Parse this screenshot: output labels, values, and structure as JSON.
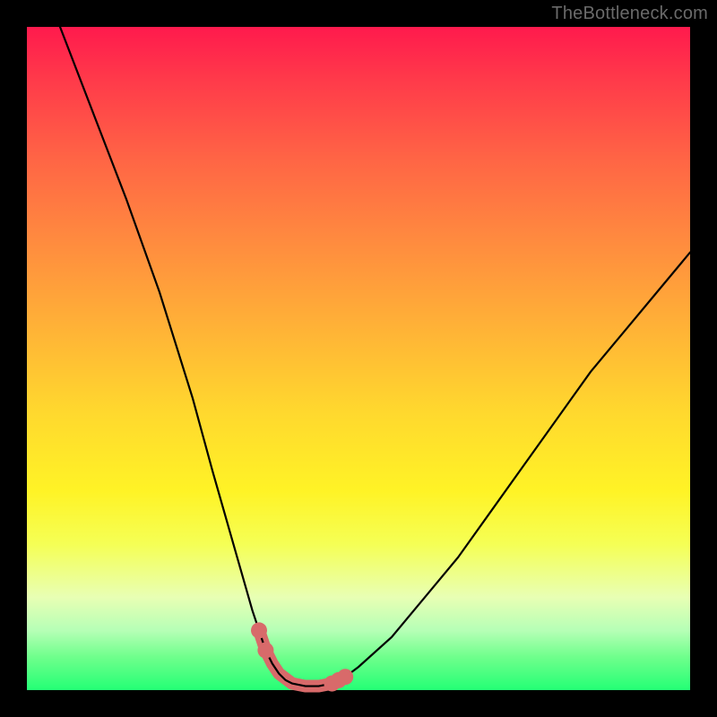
{
  "watermark": "TheBottleneck.com",
  "chart_data": {
    "type": "line",
    "title": "",
    "xlabel": "",
    "ylabel": "",
    "xlim": [
      0,
      100
    ],
    "ylim": [
      0,
      100
    ],
    "grid": false,
    "curve": {
      "x": [
        5,
        10,
        15,
        20,
        25,
        28,
        30,
        32,
        34,
        35,
        36,
        37,
        38,
        39,
        40,
        42,
        44,
        46,
        48,
        50,
        55,
        60,
        65,
        70,
        75,
        80,
        85,
        90,
        95,
        100
      ],
      "y": [
        100,
        87,
        74,
        60,
        44,
        33,
        26,
        19,
        12,
        9,
        6,
        4,
        2.5,
        1.5,
        1,
        0.6,
        0.6,
        1,
        2,
        3.5,
        8,
        14,
        20,
        27,
        34,
        41,
        48,
        54,
        60,
        66
      ]
    },
    "highlight": {
      "x": [
        35,
        36,
        37,
        38,
        40,
        42,
        44,
        46,
        47,
        48
      ],
      "y": [
        9,
        6,
        4,
        2.5,
        1,
        0.6,
        0.6,
        1,
        1.5,
        2
      ]
    },
    "highlight_dots": {
      "x": [
        35,
        36,
        46,
        47,
        48
      ],
      "y": [
        9,
        6,
        1,
        1.5,
        2
      ]
    }
  }
}
